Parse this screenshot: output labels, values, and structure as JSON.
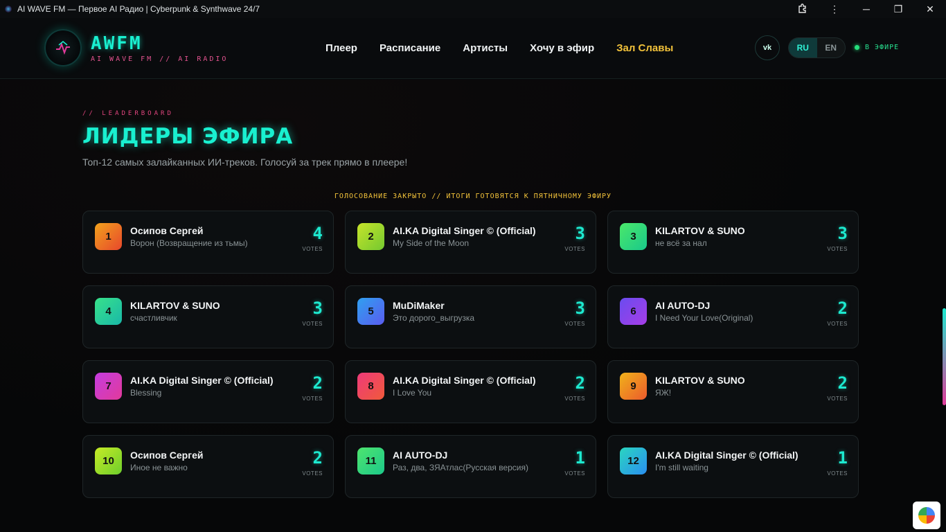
{
  "window": {
    "title": "AI WAVE FM — Первое AI Радио | Cyberpunk & Synthwave 24/7",
    "controls": [
      "minimize",
      "maximize",
      "close"
    ]
  },
  "header": {
    "logo": "AWFM",
    "logo_sub": "AI WAVE FM // AI RADIO",
    "nav": [
      {
        "label": "Плеер"
      },
      {
        "label": "Расписание"
      },
      {
        "label": "Артисты"
      },
      {
        "label": "Хочу в эфир"
      },
      {
        "label": "Зал Славы",
        "active": true
      }
    ],
    "vk_label": "vk",
    "lang": {
      "ru": "RU",
      "en": "EN",
      "selected": "RU"
    },
    "onair": "В ЭФИРЕ",
    "colors": {
      "accent": "#19f0d0",
      "active_nav": "#f2c23a",
      "pink": "#e0457e"
    }
  },
  "main": {
    "eyebrow": "// LEADERBOARD",
    "title": "ЛИДЕРЫ ЭФИРА",
    "subtitle": "Топ-12 самых залайканных ИИ-треков. Голосуй за трек прямо в плеере!",
    "notice": "ГОЛОСОВАНИЕ ЗАКРЫТО // ИТОГИ ГОТОВЯТСЯ К ПЯТНИЧНОМУ ЭФИРУ",
    "votes_label": "VOTES",
    "tracks": [
      {
        "rank": "1",
        "artist": "Осипов Сергей",
        "track": "Ворон (Возвращение из тьмы)",
        "votes": "4",
        "color": "linear-gradient(135deg,#f1a21c,#e8472c)"
      },
      {
        "rank": "2",
        "artist": "AI.KA Digital Singer © (Official)",
        "track": "My Side of the Moon",
        "votes": "3",
        "color": "linear-gradient(135deg,#c6e42a,#74c930)"
      },
      {
        "rank": "3",
        "artist": "KILARTOV & SUNO",
        "track": "не всё за нал",
        "votes": "3",
        "color": "linear-gradient(135deg,#4be86a,#19c98b)"
      },
      {
        "rank": "4",
        "artist": "KILARTOV & SUNO",
        "track": "счастливчик",
        "votes": "3",
        "color": "linear-gradient(135deg,#38e28a,#19b8a8)"
      },
      {
        "rank": "5",
        "artist": "MuDiMaker",
        "track": "Это дорого_выгрузка",
        "votes": "3",
        "color": "linear-gradient(135deg,#2fa0f0,#5a5cf0)"
      },
      {
        "rank": "6",
        "artist": "AI AUTO-DJ",
        "track": "I Need Your Love(Original)",
        "votes": "2",
        "color": "linear-gradient(135deg,#6a4cf0,#a63de6)"
      },
      {
        "rank": "7",
        "artist": "AI.KA Digital Singer © (Official)",
        "track": "Blessing",
        "votes": "2",
        "color": "linear-gradient(135deg,#c43ce0,#e23a9a)"
      },
      {
        "rank": "8",
        "artist": "AI.KA Digital Singer © (Official)",
        "track": "I Love You",
        "votes": "2",
        "color": "linear-gradient(135deg,#ee3a7a,#f05a3a)"
      },
      {
        "rank": "9",
        "artist": "KILARTOV & SUNO",
        "track": "ЯЖ!",
        "votes": "2",
        "color": "linear-gradient(135deg,#f0b21a,#ec5a2c)"
      },
      {
        "rank": "10",
        "artist": "Осипов Сергей",
        "track": "Иное не важно",
        "votes": "2",
        "color": "linear-gradient(135deg,#c6ea26,#6ecf2c)"
      },
      {
        "rank": "11",
        "artist": "AI AUTO-DJ",
        "track": "Раз, два, ЗЯАтлас(Русская версия)",
        "votes": "1",
        "color": "linear-gradient(135deg,#4ee46e,#1cc98a)"
      },
      {
        "rank": "12",
        "artist": "AI.KA Digital Singer © (Official)",
        "track": "I'm still waiting",
        "votes": "1",
        "color": "linear-gradient(135deg,#2ad6c0,#2a8ef0)"
      }
    ]
  }
}
